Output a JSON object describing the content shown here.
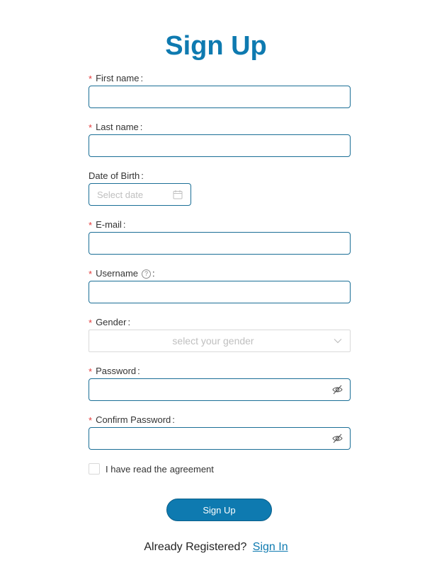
{
  "title": "Sign Up",
  "fields": {
    "first_name": {
      "label": "First name",
      "required": true,
      "value": ""
    },
    "last_name": {
      "label": "Last name",
      "required": true,
      "value": ""
    },
    "dob": {
      "label": "Date of Birth",
      "required": false,
      "placeholder": "Select date",
      "icon": "calendar-icon"
    },
    "email": {
      "label": "E-mail",
      "required": true,
      "value": ""
    },
    "username": {
      "label": "Username",
      "required": true,
      "value": "",
      "help_icon": "question-circle-icon"
    },
    "gender": {
      "label": "Gender",
      "required": true,
      "placeholder": "select your gender",
      "icon": "chevron-down-icon"
    },
    "password": {
      "label": "Password",
      "required": true,
      "value": "",
      "icon": "eye-slash-icon"
    },
    "confirm_password": {
      "label": "Confirm Password",
      "required": true,
      "value": "",
      "icon": "eye-slash-icon"
    }
  },
  "required_marker": "*",
  "colon": ":",
  "agreement": {
    "prefix": "I have read the",
    "link": "agreement",
    "checked": false
  },
  "submit_label": "Sign Up",
  "footer": {
    "text": "Already Registered?",
    "link": "Sign In"
  },
  "colors": {
    "accent": "#0e7ab0",
    "required": "#e33a3a",
    "input_border": "#1a6e96"
  }
}
